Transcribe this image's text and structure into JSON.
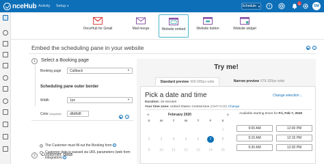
{
  "topbar": {
    "logo_text": "nceHub",
    "nav": [
      {
        "label": "Activity"
      },
      {
        "label": "Setup"
      }
    ],
    "schedule_label": "Schedule",
    "notification_count": "1",
    "avatar_initials": "SM"
  },
  "tiles": [
    {
      "label": "OnceHub for Gmail",
      "icon": "gmail-icon"
    },
    {
      "label": "Mail merge",
      "icon": "mail-merge-icon"
    },
    {
      "label": "Website embed",
      "icon": "website-embed-icon"
    },
    {
      "label": "Website button",
      "icon": "website-button-icon"
    },
    {
      "label": "Website widget",
      "icon": "website-widget-icon"
    }
  ],
  "page": {
    "title": "Embed the scheduling pane in your website"
  },
  "step1": {
    "number": "1",
    "title": "Select a Booking page",
    "booking_page_label": "Booking page",
    "booking_page_value": "Callback",
    "border_title": "Scheduling pane outer border",
    "width_label": "Width",
    "width_value": "1px",
    "color_label": "Color",
    "color_required": "(required)",
    "color_value": "d8d8d8"
  },
  "step2": {
    "number": "2",
    "title": "Customer data",
    "option1": "The Customer must fill out the Booking form",
    "option2_line1": "Customer data is passed via URL parameters (web form",
    "option2_line2": "integration)"
  },
  "preview": {
    "tryme": "Try me!",
    "tab_standard_bold": "Standard preview",
    "tab_standard_dim": "900-585px wide",
    "tab_narrow_bold": "Narrow preview",
    "tab_narrow_dim": "579-320px wide",
    "title": "Pick a date and time",
    "duration_label": "Duration:",
    "duration_value": "15 minutes",
    "timezone_label": "Your time zone:",
    "timezone_value": "United States; Central time",
    "timezone_gmt": "(GMT-6:00)",
    "timezone_change": "Change",
    "change_selection": "Change selection",
    "month": "February 2020",
    "dows": [
      "S",
      "M",
      "T",
      "W",
      "T",
      "F",
      "S"
    ],
    "row1": [
      "",
      "",
      "",
      "",
      "",
      "",
      "1"
    ],
    "row2": [
      "2",
      "3",
      "4",
      "5",
      "6",
      "7",
      "8"
    ],
    "row3": [
      "9",
      "10",
      "11",
      "12",
      "13",
      "14",
      "15"
    ],
    "selected_day": "7",
    "avail_prefix": "Available starting times for",
    "avail_date": "Fri, Feb 7, 2020",
    "slots": [
      "9:00 AM",
      "12:00 PM",
      "9:15 AM",
      "12:15 PM",
      "9:30 AM",
      "12:30 PM"
    ]
  }
}
